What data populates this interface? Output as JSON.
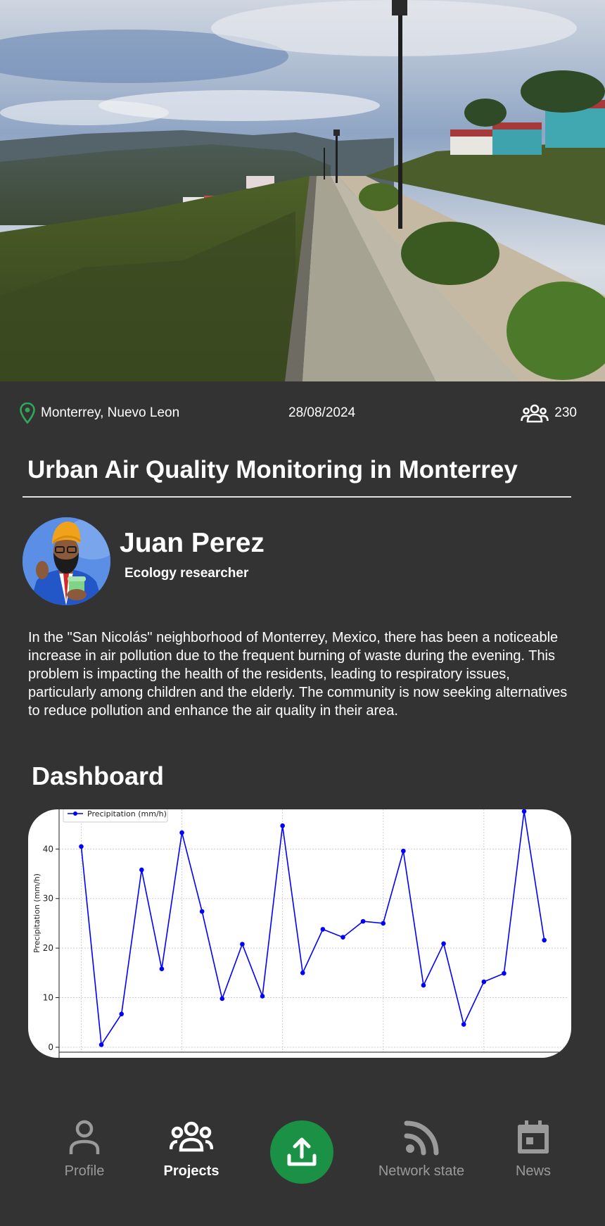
{
  "project": {
    "location": "Monterrey, Nuevo Leon",
    "date": "28/08/2024",
    "participants": "230",
    "title": "Urban Air Quality Monitoring in Monterrey",
    "description": "In the \"San Nicolás\" neighborhood of Monterrey, Mexico, there has been a noticeable increase in air pollution due to the frequent burning of waste during the evening. This problem is impacting the health of the residents, leading to respiratory issues, particularly among children and the elderly. The community is now seeking alternatives to reduce pollution and enhance the air quality in their area."
  },
  "author": {
    "name": "Juan Perez",
    "role": "Ecology researcher"
  },
  "dashboard": {
    "title": "Dashboard"
  },
  "icons": {
    "location": "map-pin-icon",
    "participants": "group-icon",
    "profile": "person-icon",
    "projects": "group-icon",
    "upload": "upload-icon",
    "network": "rss-icon",
    "news": "calendar-icon"
  },
  "colors": {
    "background": "#333333",
    "accent_green": "#1a9144",
    "series_blue": "#0000ff",
    "nav_inactive": "#9a9a9a"
  },
  "nav": {
    "profile": "Profile",
    "projects": "Projects",
    "network": "Network state",
    "news": "News",
    "active": "Projects"
  },
  "chart_data": {
    "type": "line",
    "ylabel": "Precipitation (mm/h)",
    "xlabel": "",
    "legend": "top-left",
    "grid": true,
    "ylim": [
      -1,
      48
    ],
    "xlim": [
      -1.1,
      24.2
    ],
    "yticks": [
      "0",
      "10",
      "20",
      "30",
      "40"
    ],
    "series": [
      {
        "name": "Precipitation (mm/h)",
        "color": "#0000ff",
        "x": [
          0,
          1,
          2,
          3,
          4,
          5,
          6,
          7,
          8,
          9,
          10,
          11,
          12,
          13,
          14,
          15,
          16,
          17,
          18,
          19,
          20,
          21,
          22,
          23
        ],
        "values": [
          40.5,
          0.5,
          6.7,
          35.8,
          15.8,
          43.3,
          27.4,
          9.8,
          20.8,
          10.3,
          44.7,
          15.0,
          23.8,
          22.2,
          25.4,
          25.0,
          39.6,
          12.5,
          20.9,
          4.6,
          13.2,
          14.9,
          47.6,
          21.6
        ]
      }
    ]
  }
}
